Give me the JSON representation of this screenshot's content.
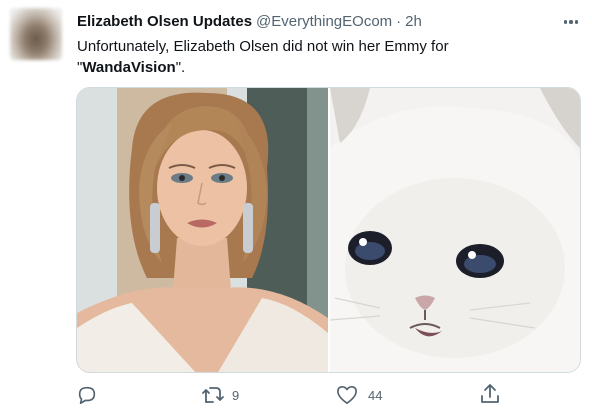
{
  "tweet": {
    "display_name": "Elizabeth Olsen Updates",
    "handle": "@EverythingEOcom",
    "separator": "·",
    "time": "2h",
    "text_before": "Unfortunately, Elizabeth Olsen did not win her Emmy for \"",
    "text_bold": "WandaVision",
    "text_after": "\"."
  },
  "actions": {
    "retweet_count": "9",
    "like_count": "44"
  },
  "colors": {
    "text": "#0f1419",
    "secondary": "#536471",
    "border": "#cfd9de"
  },
  "icons": [
    "more-icon",
    "reply-icon",
    "retweet-icon",
    "like-icon",
    "share-icon"
  ]
}
